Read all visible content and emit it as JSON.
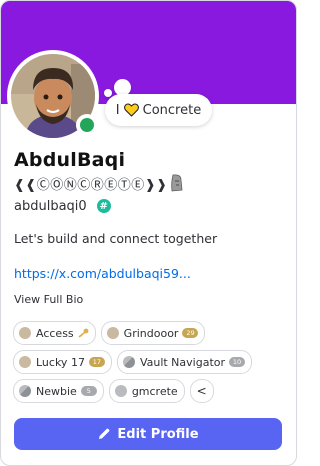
{
  "profile": {
    "status_prefix": "I",
    "status_text": "Concrete",
    "display_name": "AbdulBaqi",
    "clan_tag": "❰❰ⒸⓄⓃⒸⓇⒺⓉⒺ❱❱",
    "username": "abdulbaqi0",
    "hash_badge": "#",
    "bio": "Let's build and connect together",
    "link": "https://x.com/abdulbaqi59...",
    "view_full_bio": "View Full Bio"
  },
  "badges": [
    {
      "label": "Access",
      "icon": "access-badge-icon"
    },
    {
      "label": "Grindooor",
      "level": "29",
      "icon": "grindooor-badge-icon"
    },
    {
      "label": "Lucky 17",
      "level": "17",
      "icon": "lucky-badge-icon"
    },
    {
      "label": "Vault Navigator",
      "level": "10",
      "icon": "vault-badge-icon"
    },
    {
      "label": "Newbie",
      "level": "5",
      "icon": "newbie-badge-icon"
    },
    {
      "label": "gmcrete",
      "icon": "gmcrete-badge-icon"
    }
  ],
  "collapse_symbol": "<",
  "actions": {
    "edit_profile": "Edit Profile"
  },
  "colors": {
    "banner": "#8a19e0",
    "button": "#5865f2",
    "online": "#23a55a",
    "link": "#006ce7",
    "hash_badge": "#1abc9c"
  }
}
